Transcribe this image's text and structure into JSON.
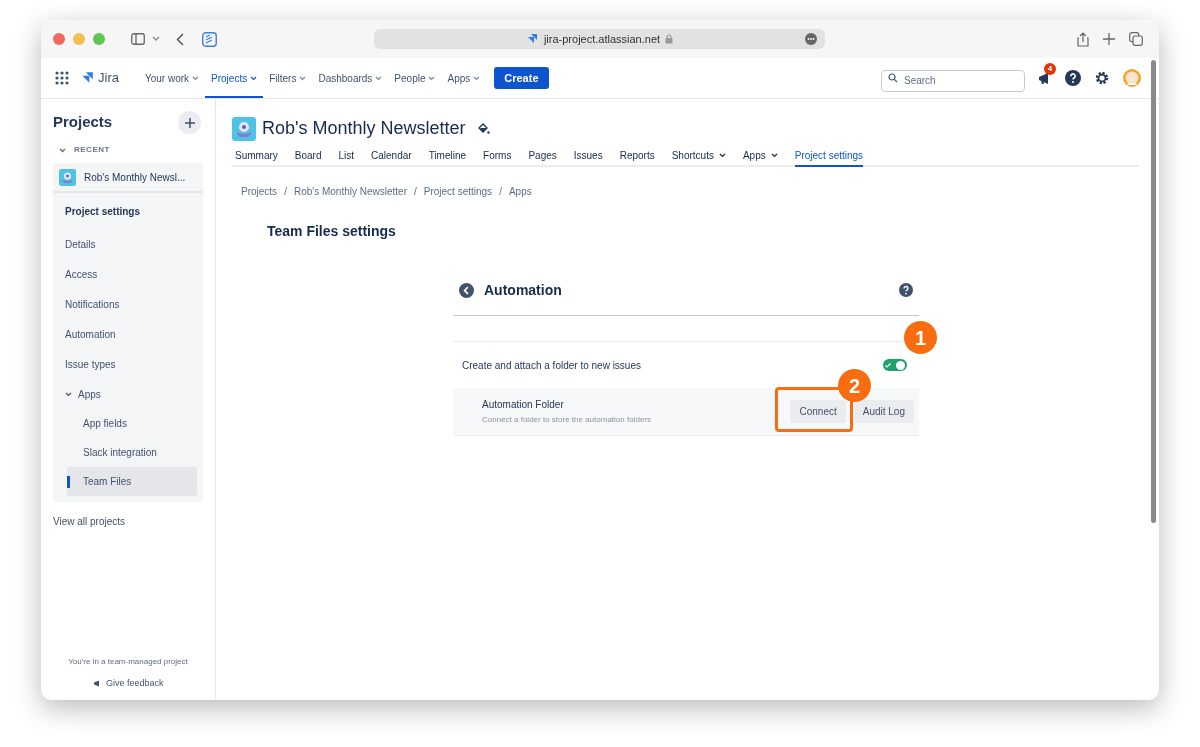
{
  "browser": {
    "url": "jira-project.atlassian.net"
  },
  "nav": {
    "product": "Jira",
    "items": [
      {
        "label": "Your work",
        "selected": false
      },
      {
        "label": "Projects",
        "selected": true
      },
      {
        "label": "Filters",
        "selected": false
      },
      {
        "label": "Dashboards",
        "selected": false
      },
      {
        "label": "People",
        "selected": false
      },
      {
        "label": "Apps",
        "selected": false
      }
    ],
    "create_button": "Create",
    "search": {
      "placeholder": "Search"
    },
    "notification_count": "4"
  },
  "sidebar": {
    "title": "Projects",
    "section": "RECENT",
    "project": "Rob's Monthly Newsl...",
    "settings_title": "Project settings",
    "items": [
      {
        "label": "Details",
        "selected": false
      },
      {
        "label": "Access",
        "selected": false
      },
      {
        "label": "Notifications",
        "selected": false
      },
      {
        "label": "Automation",
        "selected": false
      },
      {
        "label": "Issue types",
        "selected": false
      },
      {
        "label": "Apps",
        "selected": false,
        "expanded": true,
        "children": [
          {
            "label": "App fields",
            "selected": false
          },
          {
            "label": "Slack integration",
            "selected": false
          },
          {
            "label": "Team Files",
            "selected": true
          }
        ]
      }
    ],
    "view_all": "View all projects",
    "footer": "You're in a team-managed project",
    "feedback": "Give feedback"
  },
  "project": {
    "title": "Rob's Monthly Newsletter",
    "tabs": [
      {
        "label": "Summary",
        "selected": false,
        "dropdown": false
      },
      {
        "label": "Board",
        "selected": false,
        "dropdown": false
      },
      {
        "label": "List",
        "selected": false,
        "dropdown": false
      },
      {
        "label": "Calendar",
        "selected": false,
        "dropdown": false
      },
      {
        "label": "Timeline",
        "selected": false,
        "dropdown": false
      },
      {
        "label": "Forms",
        "selected": false,
        "dropdown": false
      },
      {
        "label": "Pages",
        "selected": false,
        "dropdown": false
      },
      {
        "label": "Issues",
        "selected": false,
        "dropdown": false
      },
      {
        "label": "Reports",
        "selected": false,
        "dropdown": false
      },
      {
        "label": "Shortcuts",
        "selected": false,
        "dropdown": true
      },
      {
        "label": "Apps",
        "selected": false,
        "dropdown": true
      },
      {
        "label": "Project settings",
        "selected": true,
        "dropdown": false
      }
    ]
  },
  "breadcrumbs": {
    "separator": "/",
    "items": [
      "Projects",
      "Rob's Monthly Newsletter",
      "Project settings",
      "Apps"
    ]
  },
  "page_title": "Team Files settings",
  "panel": {
    "title": "Automation",
    "toggle_row": {
      "label": "Create and attach a folder to new issues",
      "on": true
    },
    "folder_row": {
      "title": "Automation Folder",
      "description": "Connect a folder to store the automation folders",
      "buttons": [
        "Connect",
        "Audit Log"
      ]
    }
  },
  "callouts": [
    "1",
    "2"
  ]
}
